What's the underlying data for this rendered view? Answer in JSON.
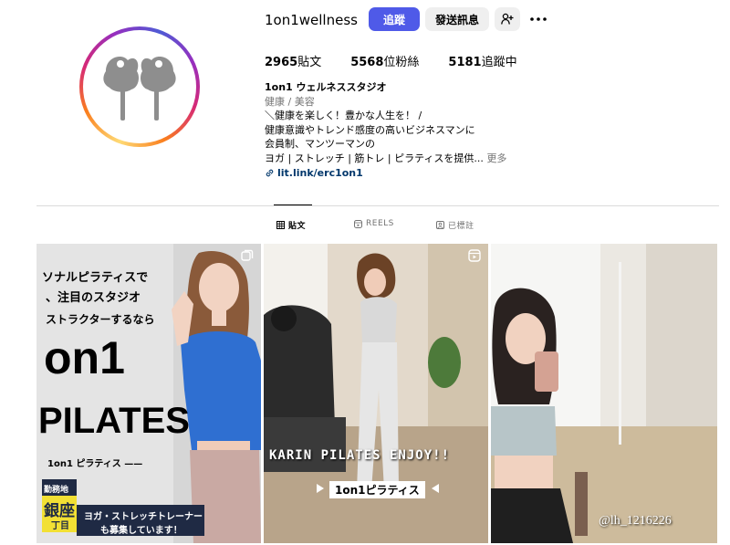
{
  "profile": {
    "username": "1on1wellness",
    "follow_label": "追蹤",
    "message_label": "發送訊息",
    "add_user_icon": "add-user-icon",
    "more_icon": "more-options-icon"
  },
  "stats": {
    "posts_count": "2965",
    "posts_label": "貼文",
    "followers_count": "5568",
    "followers_label": "位粉絲",
    "following_count": "5181",
    "following_label": "追蹤中"
  },
  "bio": {
    "name": "1on1 ウェルネススタジオ",
    "category": "健康 / 美容",
    "line1": "＼健康を楽しく！豊かな人生を！ /",
    "line2": "健康意識やトレンド感度の高いビジネスマンに",
    "line3": "会員制、マンツーマンの",
    "line4": "ヨガ | ストレッチ | 筋トレ | ピラティスを提供...",
    "more_label": "更多",
    "link": "lit.link/erc1on1"
  },
  "tabs": [
    {
      "label": "貼文",
      "icon": "grid-icon",
      "active": true
    },
    {
      "label": "REELS",
      "icon": "reels-icon",
      "active": false
    },
    {
      "label": "已標註",
      "icon": "tagged-icon",
      "active": false
    }
  ],
  "posts": [
    {
      "line1": "ソナルピラティスで",
      "line2": "、注目のスタジオ",
      "line3": "ストラクターするなら",
      "big1": "on1",
      "big2": "PILATES",
      "sub": "1on1 ピラティス ——",
      "badge1": "勤務地",
      "badge2": "銀座",
      "badge3": "丁目",
      "footer1": "ヨガ・ストレッチトレーナー",
      "footer2": "も募集しています！"
    },
    {
      "caption": "KARIN PILATES ENJOY!!",
      "sub": "1on1ピラティス"
    },
    {
      "watermark": "@lh_1216226"
    }
  ],
  "colors": {
    "follow_button": "#4f5ae8",
    "link": "#00376b",
    "muted": "#737373"
  }
}
